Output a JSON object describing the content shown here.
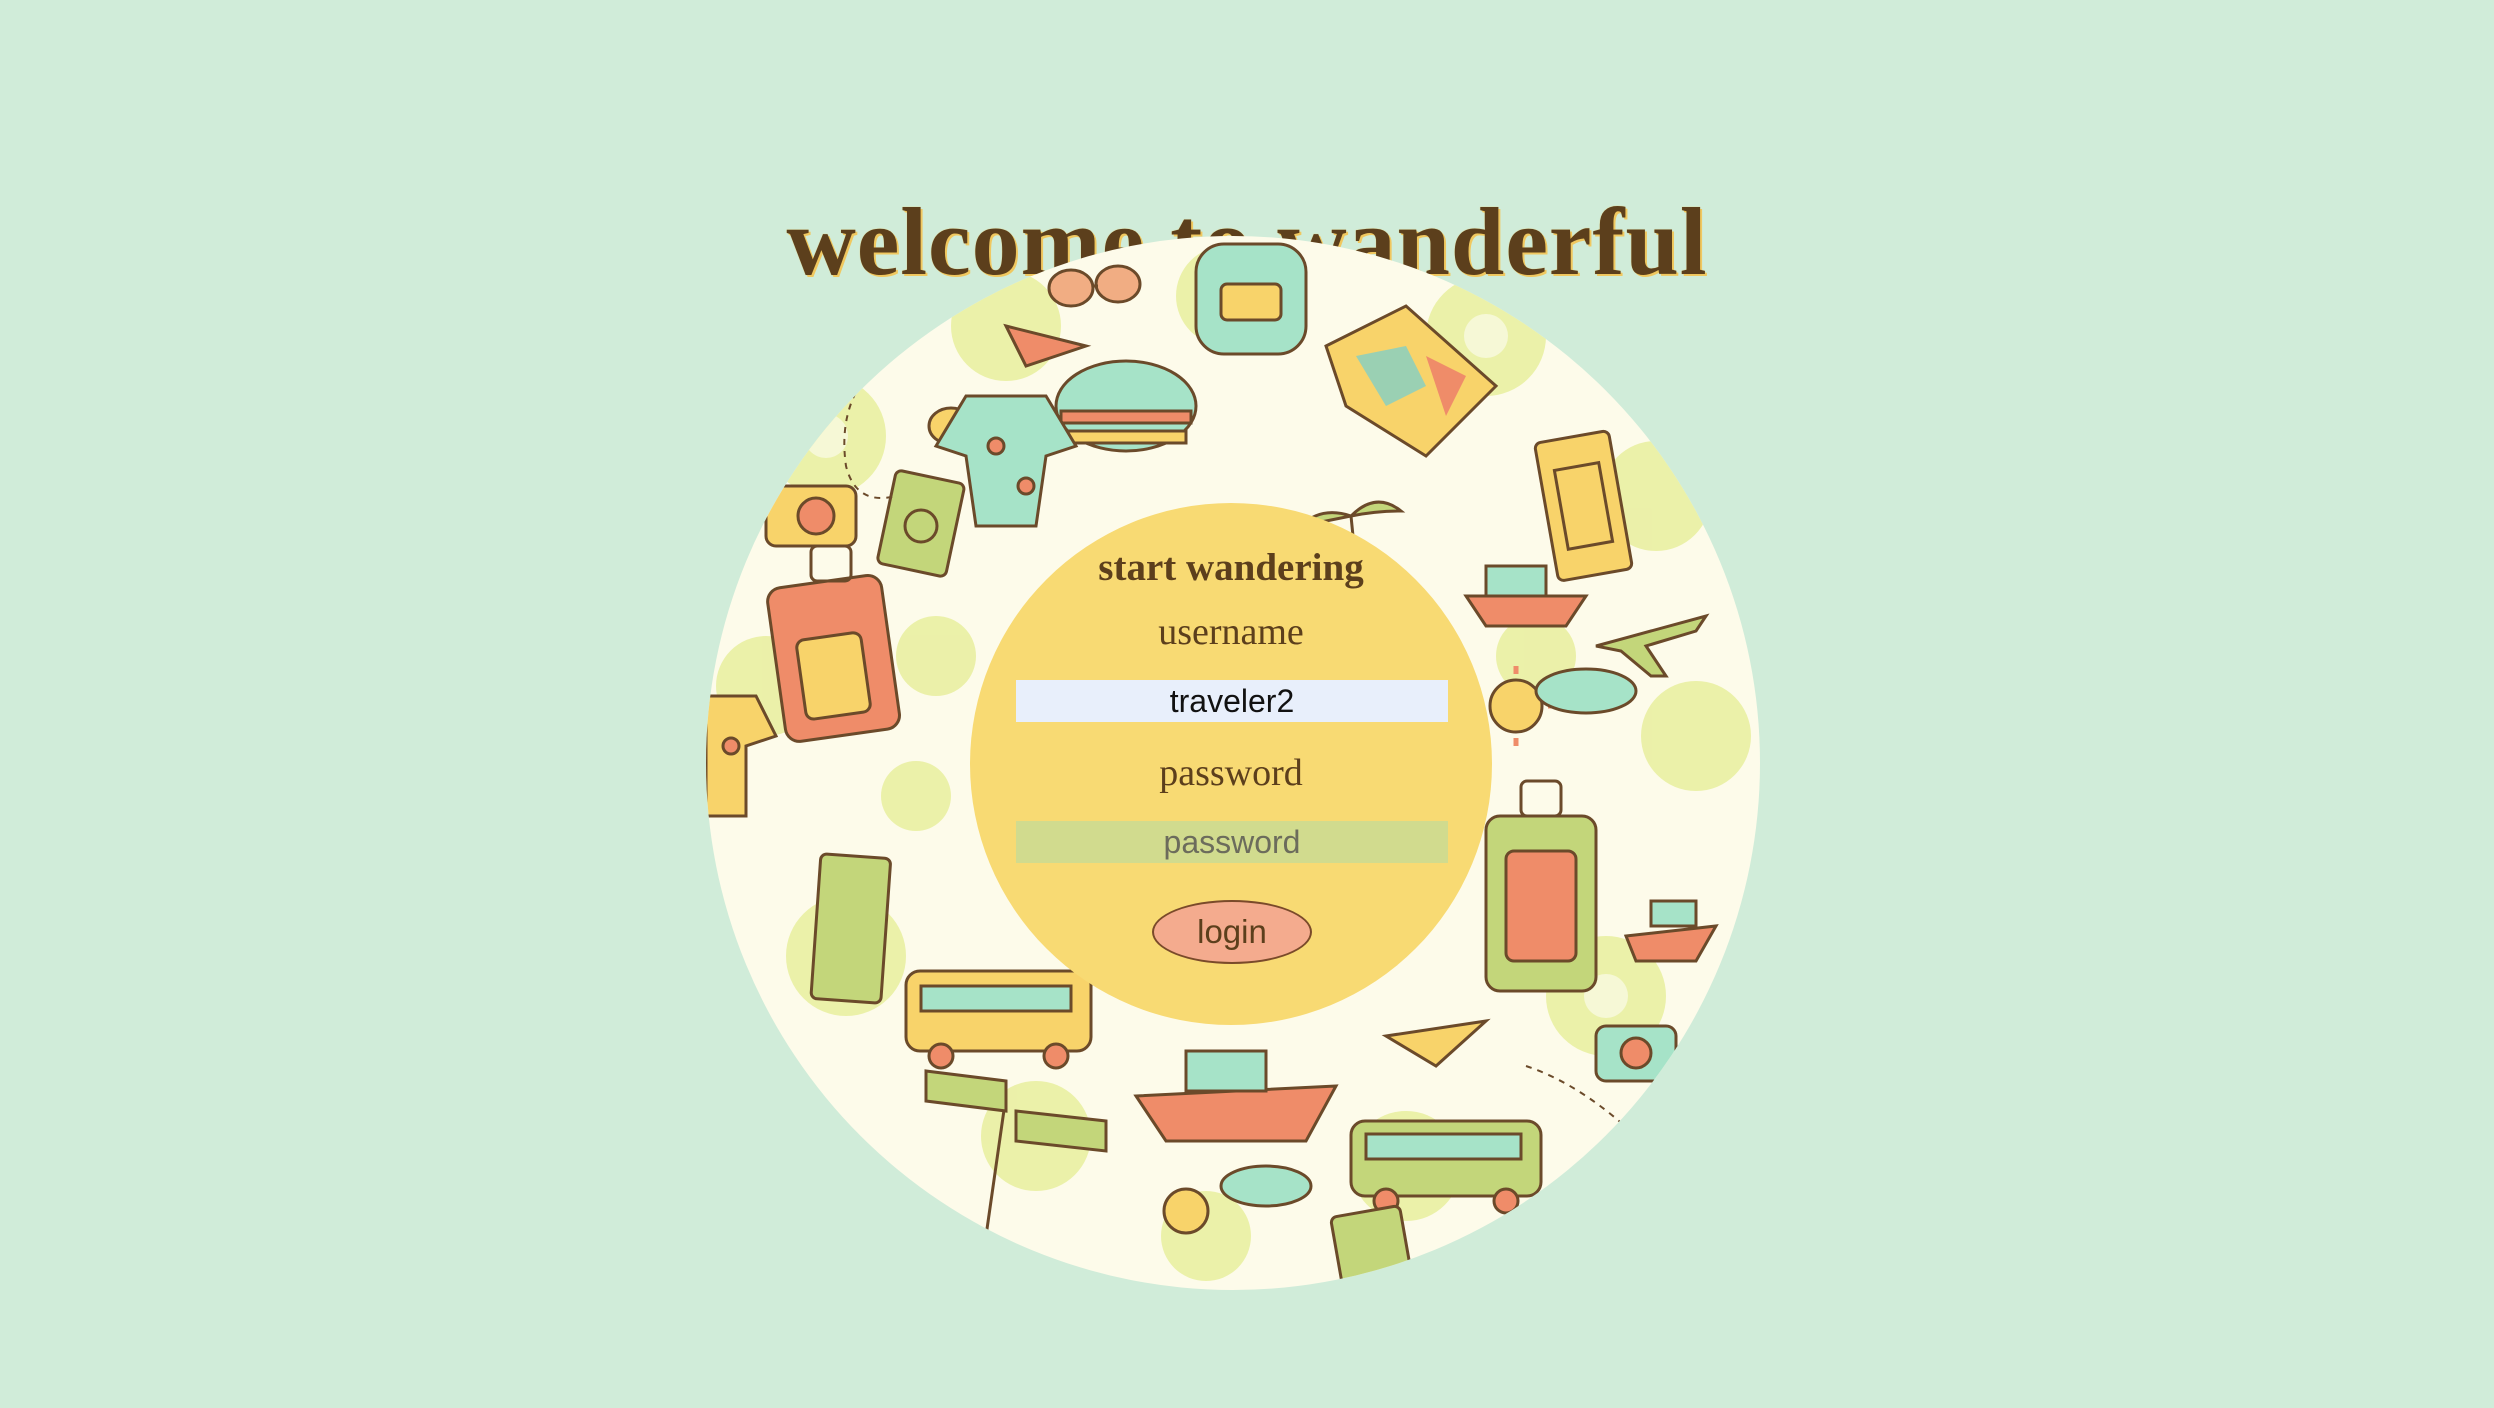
{
  "header": {
    "title": "welcome to wanderful"
  },
  "form": {
    "heading": "start wandering",
    "username_label": "username",
    "username_value": "traveler2",
    "password_label": "password",
    "password_placeholder": "password",
    "login_label": "login"
  },
  "colors": {
    "background": "#d0ecd9",
    "form_circle": "#f8da73",
    "title_text": "#5c3f1c",
    "login_button": "#f4ab8e",
    "password_field": "#d1db8e",
    "username_field": "#e8effb"
  },
  "decor": {
    "pattern_icons": [
      "suitcase-icon",
      "passport-icon",
      "camera-icon",
      "sunglasses-icon",
      "airplane-icon",
      "bus-icon",
      "ship-icon",
      "map-icon",
      "palm-tree-icon",
      "sun-icon",
      "cloud-icon",
      "backpack-icon",
      "paper-plane-icon",
      "signpost-icon",
      "shirt-icon"
    ]
  }
}
